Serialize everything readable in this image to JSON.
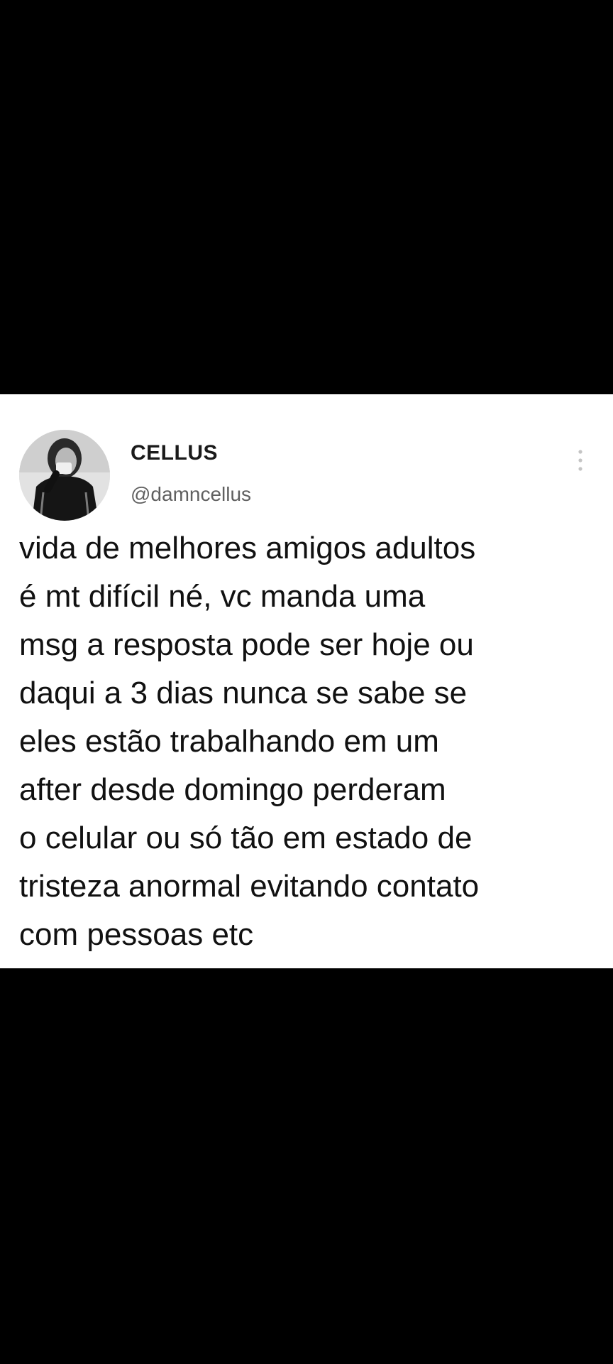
{
  "tweet": {
    "display_name": "CELLUS",
    "handle": "@damncellus",
    "more_icon": "vertical-ellipsis-icon",
    "avatar": "profile-photo",
    "text_lines": [
      "vida de melhores amigos adultos",
      "é mt difícil né, vc manda uma",
      "msg a resposta pode ser hoje ou",
      "daqui a 3 dias nunca se sabe se",
      "eles estão trabalhando em um",
      "after desde domingo perderam",
      "o celular ou só tão em estado de",
      "tristeza anormal evitando contato",
      "com pessoas etc"
    ]
  },
  "colors": {
    "background": "#000000",
    "card": "#ffffff",
    "name": "#1a1a1a",
    "handle": "#606060",
    "text": "#111111"
  }
}
